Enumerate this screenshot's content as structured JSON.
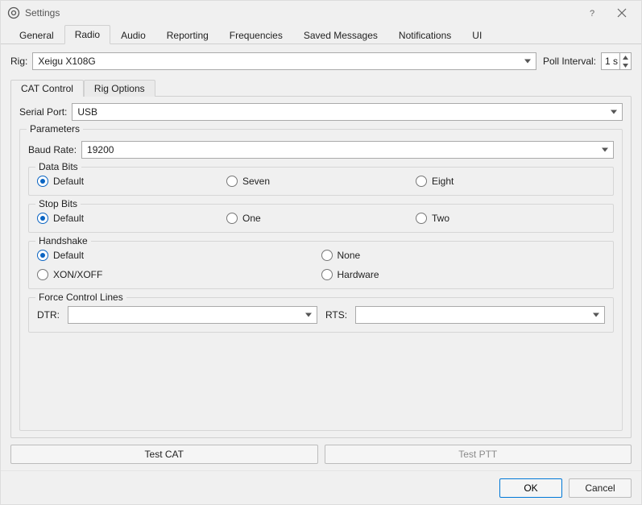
{
  "window": {
    "title": "Settings"
  },
  "tabs": {
    "general": "General",
    "radio": "Radio",
    "audio": "Audio",
    "reporting": "Reporting",
    "frequencies": "Frequencies",
    "saved_messages": "Saved Messages",
    "notifications": "Notifications",
    "ui": "UI"
  },
  "rig": {
    "label": "Rig:",
    "value": "Xeigu X108G",
    "poll_label": "Poll Interval:",
    "poll_value": "1 s"
  },
  "subtabs": {
    "cat": "CAT Control",
    "rig_options": "Rig Options"
  },
  "serial": {
    "label": "Serial Port:",
    "value": "USB"
  },
  "parameters": {
    "legend": "Parameters",
    "baud": {
      "label": "Baud Rate:",
      "value": "19200"
    },
    "data_bits": {
      "legend": "Data Bits",
      "options": {
        "default": "Default",
        "seven": "Seven",
        "eight": "Eight"
      },
      "selected": "default"
    },
    "stop_bits": {
      "legend": "Stop Bits",
      "options": {
        "default": "Default",
        "one": "One",
        "two": "Two"
      },
      "selected": "default"
    },
    "handshake": {
      "legend": "Handshake",
      "options": {
        "default": "Default",
        "none": "None",
        "xonxoff": "XON/XOFF",
        "hardware": "Hardware"
      },
      "selected": "default"
    },
    "force_control": {
      "legend": "Force Control Lines",
      "dtr_label": "DTR:",
      "dtr_value": "",
      "rts_label": "RTS:",
      "rts_value": ""
    }
  },
  "test": {
    "cat": "Test CAT",
    "ptt": "Test PTT"
  },
  "buttons": {
    "ok": "OK",
    "cancel": "Cancel"
  }
}
